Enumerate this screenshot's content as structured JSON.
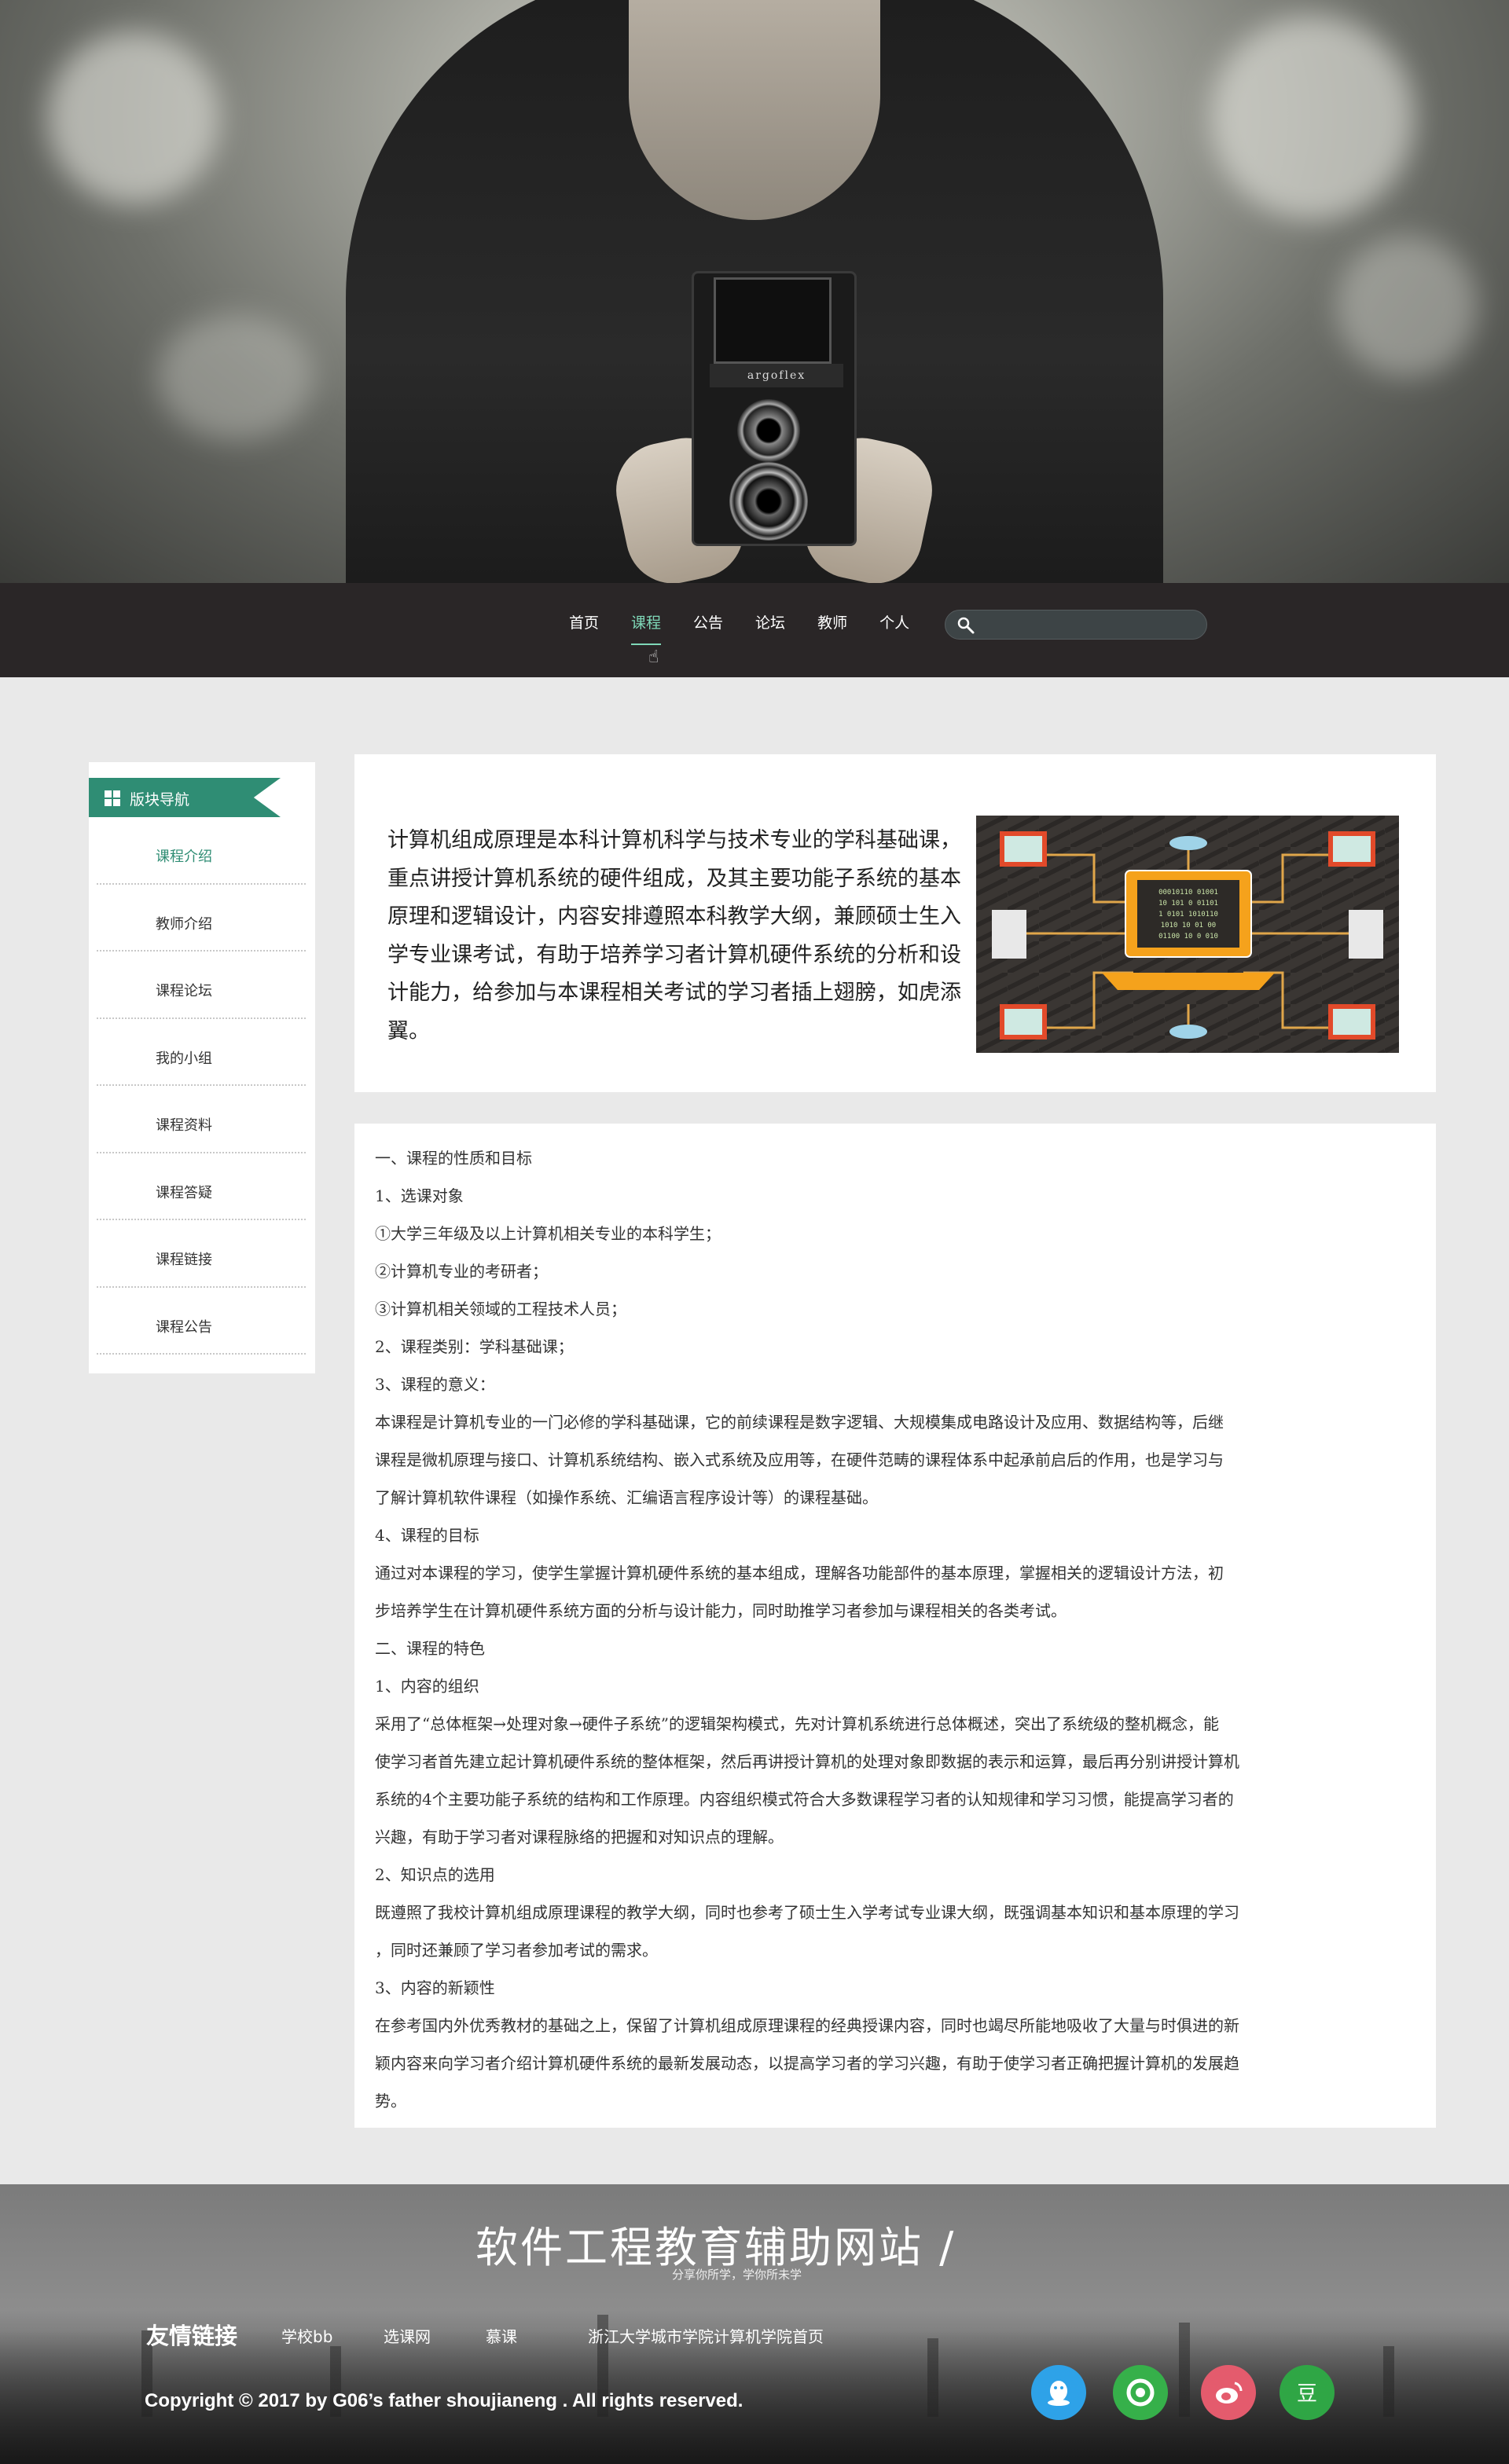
{
  "nav": {
    "items": [
      "首页",
      "课程",
      "公告",
      "论坛",
      "教师",
      "个人"
    ],
    "active_index": 1,
    "search_placeholder": ""
  },
  "camera_brand": "argoflex",
  "sidebar": {
    "title": "版块导航",
    "items": [
      "课程介绍",
      "教师介绍",
      "课程论坛",
      "我的小组",
      "课程资料",
      "课程答疑",
      "课程链接",
      "课程公告"
    ],
    "active_index": 0
  },
  "intro": {
    "text": "计算机组成原理是本科计算机科学与技术专业的学科基础课，重点讲授计算机系统的硬件组成，及其主要功能子系统的基本原理和逻辑设计，内容安排遵照本科教学大纲，兼顾硕士生入学专业课考试，有助于培养学习者计算机硬件系统的分析和设计能力，给参加与本课程相关考试的学习者插上翅膀，如虎添翼。",
    "image_alt": "network-illustration"
  },
  "detail": {
    "lines": [
      "一、课程的性质和目标",
      "1、选课对象",
      "①大学三年级及以上计算机相关专业的本科学生；",
      "②计算机专业的考研者；",
      "③计算机相关领域的工程技术人员；",
      "2、课程类别：学科基础课；",
      "3、课程的意义：",
      "本课程是计算机专业的一门必修的学科基础课，它的前续课程是数字逻辑、大规模集成电路设计及应用、数据结构等，后继",
      "课程是微机原理与接口、计算机系统结构、嵌入式系统及应用等，在硬件范畴的课程体系中起承前启后的作用，也是学习与",
      "了解计算机软件课程（如操作系统、汇编语言程序设计等）的课程基础。",
      "4、课程的目标",
      "通过对本课程的学习，使学生掌握计算机硬件系统的基本组成，理解各功能部件的基本原理，掌握相关的逻辑设计方法，初",
      "步培养学生在计算机硬件系统方面的分析与设计能力，同时助推学习者参加与课程相关的各类考试。",
      "二、课程的特色",
      "1、内容的组织",
      "采用了“总体框架→处理对象→硬件子系统”的逻辑架构模式，先对计算机系统进行总体概述，突出了系统级的整机概念，能",
      "使学习者首先建立起计算机硬件系统的整体框架，然后再讲授计算机的处理对象即数据的表示和运算，最后再分别讲授计算机",
      "系统的4个主要功能子系统的结构和工作原理。内容组织模式符合大多数课程学习者的认知规律和学习习惯，能提高学习者的",
      "兴趣，有助于学习者对课程脉络的把握和对知识点的理解。",
      "2、知识点的选用",
      "既遵照了我校计算机组成原理课程的教学大纲，同时也参考了硕士生入学考试专业课大纲，既强调基本知识和基本原理的学习",
      "，同时还兼顾了学习者参加考试的需求。",
      "3、内容的新颖性",
      "在参考国内外优秀教材的基础之上，保留了计算机组成原理课程的经典授课内容，同时也竭尽所能地吸收了大量与时俱进的新",
      "颖内容来向学习者介绍计算机硬件系统的最新发展动态，以提高学习者的学习兴趣，有助于使学习者正确把握计算机的发展趋",
      "势。"
    ]
  },
  "footer": {
    "title": "软件工程教育辅助网站 /",
    "subtitle": "分享你所学，学你所未学",
    "links_label": "友情链接",
    "links": [
      "学校bb",
      "选课网",
      "慕课",
      "浙江大学城市学院计算机学院首页"
    ],
    "copyright": "Copyright © 2017 by G06’s father shoujianeng . All rights reserved.",
    "social": [
      {
        "name": "qq-icon",
        "color": "#2ea2e8"
      },
      {
        "name": "wechat-moments-icon",
        "color": "#36b04a"
      },
      {
        "name": "weibo-icon",
        "color": "#e45b6d"
      },
      {
        "name": "douban-icon",
        "color": "#2fa645",
        "glyph": "豆"
      }
    ]
  }
}
